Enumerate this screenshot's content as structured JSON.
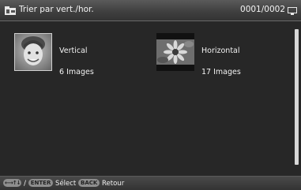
{
  "header": {
    "title": "Trier par vert./hor.",
    "page_counter": "0001/0002",
    "title_icon": "sort-folder-icon",
    "counter_icon": "frame-icon"
  },
  "folders": [
    {
      "name": "Vertical",
      "count": "6 Images",
      "thumb_icon": "portrait-photo-icon"
    },
    {
      "name": "Horizontal",
      "count": "17 Images",
      "thumb_icon": "landscape-photo-icon"
    }
  ],
  "footer": {
    "nav_key": "←→↑↓",
    "separator": "/",
    "enter_key": "ENTER",
    "enter_label": "Sélect",
    "back_key": "BACK",
    "back_label": "Retour"
  },
  "colors": {
    "background": "#262626",
    "text": "#f2f2f2",
    "key_badge": "#8e8e8e"
  }
}
